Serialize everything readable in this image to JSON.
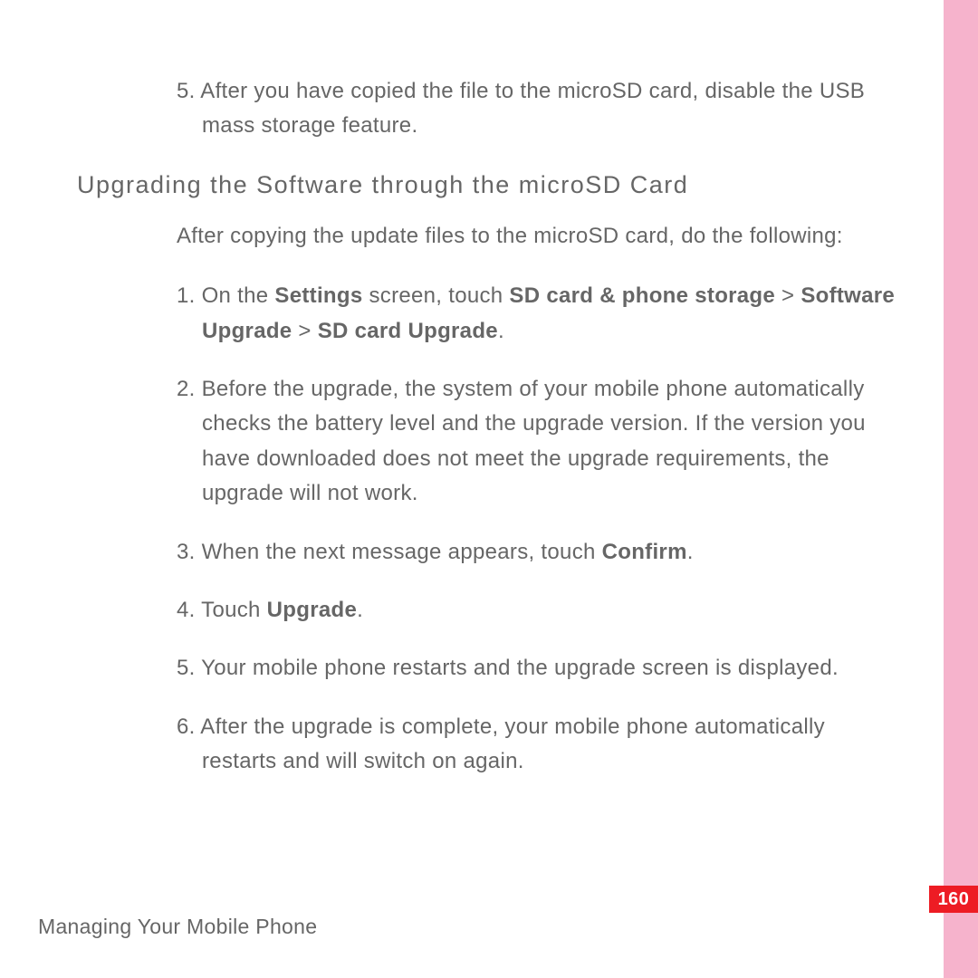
{
  "topList": {
    "item5": {
      "num": "5.",
      "text": " After you have copied the file to the microSD card, disable the USB mass storage feature."
    }
  },
  "heading": "Upgrading the Software through the microSD Card",
  "intro": "After copying the update files to the microSD card, do the following:",
  "steps": {
    "s1": {
      "num": "1.",
      "pre": " On the ",
      "b1": "Settings",
      "mid1": " screen, touch ",
      "b2": "SD card & phone storage",
      "mid2": " > ",
      "b3": "Software Upgrade",
      "mid3": " > ",
      "b4": "SD card Upgrade",
      "post": "."
    },
    "s2": {
      "num": "2.",
      "text": " Before the upgrade, the system of your mobile phone automatically checks the battery level and the upgrade version. If the version you have downloaded does not meet the upgrade requirements, the upgrade will not work."
    },
    "s3": {
      "num": "3.",
      "pre": " When the next message appears, touch ",
      "b1": "Confirm",
      "post": "."
    },
    "s4": {
      "num": "4.",
      "pre": " Touch ",
      "b1": "Upgrade",
      "post": "."
    },
    "s5": {
      "num": "5.",
      "text": " Your mobile phone restarts and the upgrade screen is displayed."
    },
    "s6": {
      "num": "6.",
      "text": " After the upgrade is complete, your mobile phone automatically restarts and will switch on again."
    }
  },
  "footer": "Managing Your Mobile Phone",
  "pageNumber": "160"
}
